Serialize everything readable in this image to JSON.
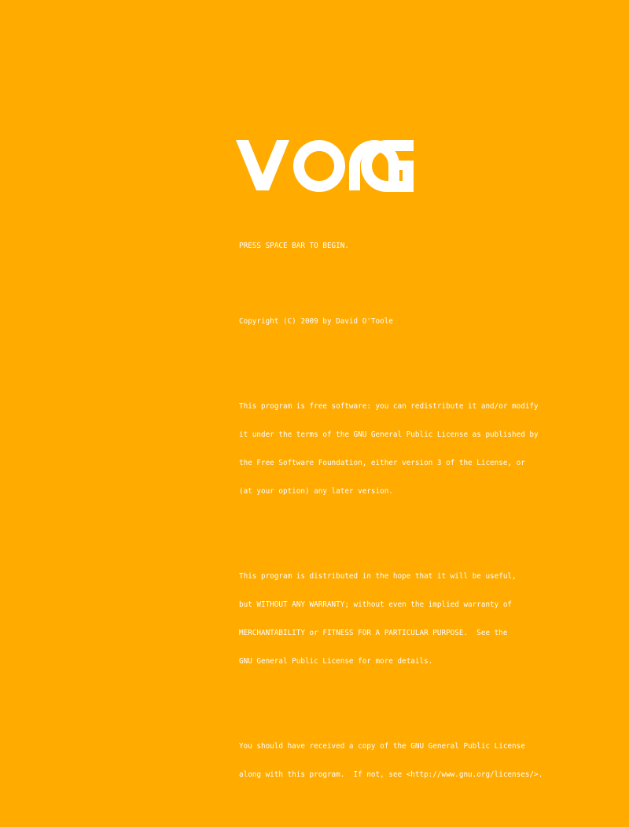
{
  "title": "VONG",
  "prompt": "PRESS SPACE BAR TO BEGIN.",
  "copyright": "Copyright (C) 2009 by David O'Toole",
  "license_paragraphs": [
    [
      "This program is free software: you can redistribute it and/or modify",
      "it under the terms of the GNU General Public License as published by",
      "the Free Software Foundation, either version 3 of the License, or",
      "(at your option) any later version."
    ],
    [
      "This program is distributed in the hope that it will be useful,",
      "but WITHOUT ANY WARRANTY; without even the implied warranty of",
      "MERCHANTABILITY or FITNESS FOR A PARTICULAR PURPOSE.  See the",
      "GNU General Public License for more details."
    ],
    [
      "You should have received a copy of the GNU General Public License",
      "along with this program.  If not, see <http://www.gnu.org/licenses/>."
    ]
  ],
  "colors": {
    "background": "#FFAB00",
    "text": "#FFFFFF"
  }
}
